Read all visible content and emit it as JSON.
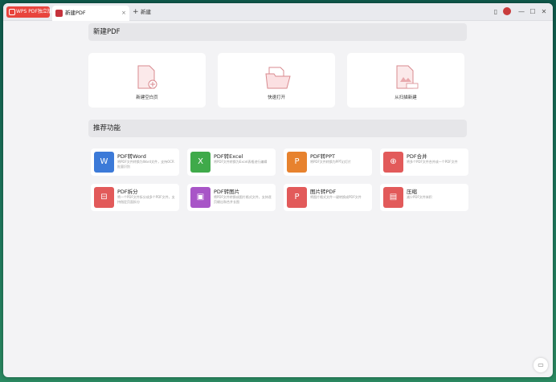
{
  "titlebar": {
    "app_badge": "WPS PDF独立版",
    "tab_title": "新建PDF",
    "tab_close": "×",
    "newtab_plus": "+",
    "newtab_label": "新建",
    "btn_min": "—",
    "btn_max": "☐",
    "btn_close": "✕"
  },
  "new_pdf": {
    "header": "新建PDF",
    "cards": [
      {
        "label": "新建空白页",
        "icon": "blank-page-plus-icon"
      },
      {
        "label": "快速打开",
        "icon": "folder-pdf-icon"
      },
      {
        "label": "从扫描新建",
        "icon": "scan-page-icon"
      }
    ]
  },
  "features": {
    "header": "推荐功能",
    "items": [
      {
        "title": "PDF转Word",
        "desc": "将PDF文件转换为Word文件，支持OCR批量识别",
        "color": "#3c7ad8",
        "icon": "W"
      },
      {
        "title": "PDF转Excel",
        "desc": "将PDF文件转换为Excel表格进行编辑",
        "color": "#3faa4a",
        "icon": "X"
      },
      {
        "title": "PDF转PPT",
        "desc": "将PDF文件转换为PPT幻灯片",
        "color": "#e7822e",
        "icon": "P"
      },
      {
        "title": "PDF合并",
        "desc": "将多个PDF文件合并成一个PDF文件",
        "color": "#e25a5a",
        "icon": "⊕"
      },
      {
        "title": "PDF拆分",
        "desc": "将一个PDF文件拆分成多个PDF文件，支持指定页面拆分",
        "color": "#e25a5a",
        "icon": "⊟"
      },
      {
        "title": "PDF转图片",
        "desc": "将PDF文件转换成图片格式文件，支持逐页输出和合并长图",
        "color": "#a855c7",
        "icon": "▣"
      },
      {
        "title": "图片转PDF",
        "desc": "将图片格式文件一键转换成PDF文件",
        "color": "#e25a5a",
        "icon": "P"
      },
      {
        "title": "压缩",
        "desc": "减少PDF文件体积",
        "color": "#e25a5a",
        "icon": "▤"
      }
    ]
  },
  "chat_icon": "▭"
}
